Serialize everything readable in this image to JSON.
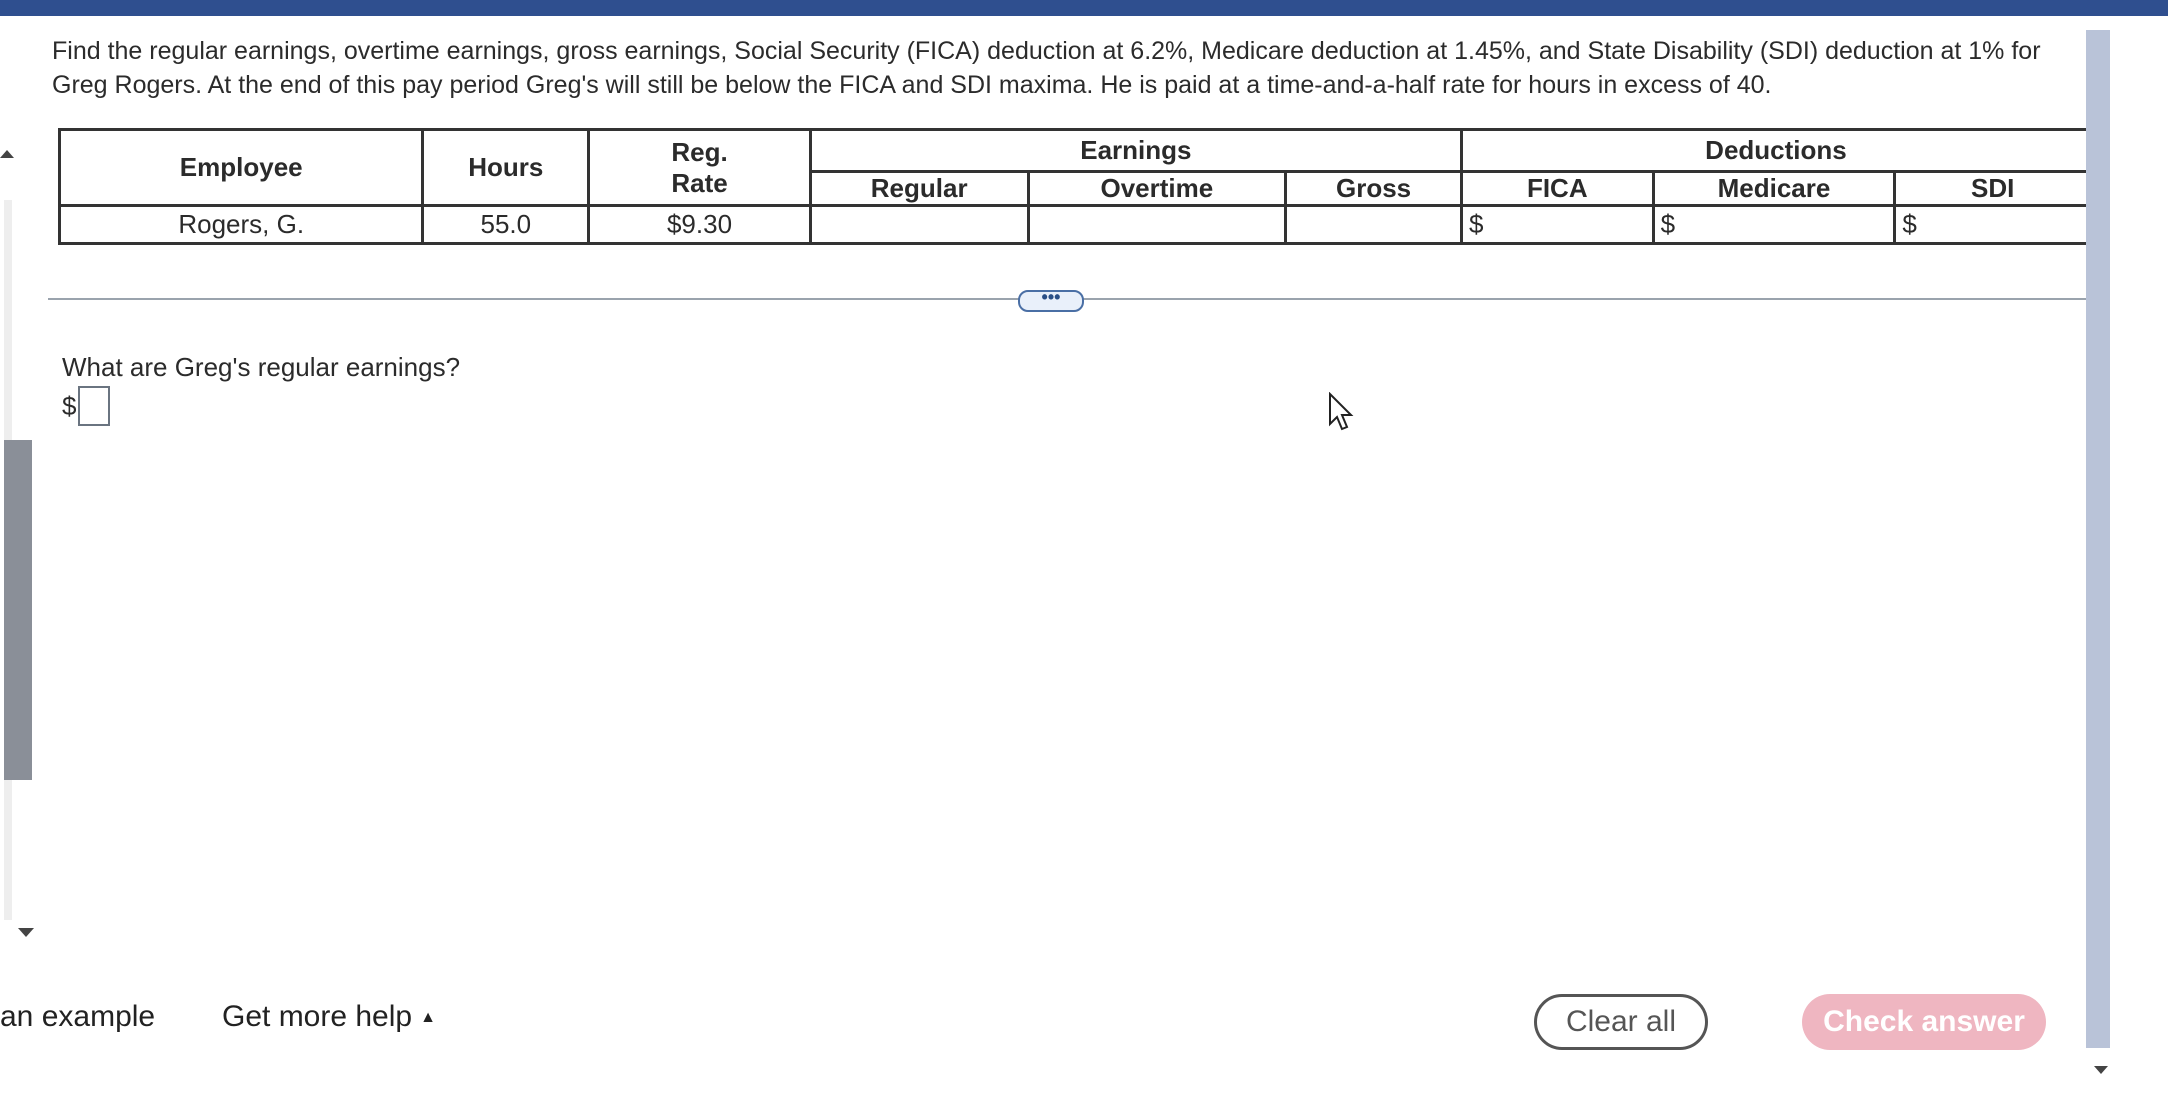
{
  "question": {
    "line1": "Find the regular earnings, overtime earnings, gross earnings, Social Security (FICA) deduction at 6.2%, Medicare deduction at 1.45%, and State Disability (SDI) deduction at 1% for",
    "line2": "Greg Rogers. At the end of this pay period Greg's will still be below the FICA and SDI maxima. He is paid at a time-and-a-half rate for hours in excess of 40."
  },
  "table": {
    "headers": {
      "employee": "Employee",
      "hours": "Hours",
      "reg_rate_line1": "Reg.",
      "reg_rate_line2": "Rate",
      "earnings": "Earnings",
      "deductions": "Deductions",
      "regular": "Regular",
      "overtime": "Overtime",
      "gross": "Gross",
      "fica": "FICA",
      "medicare": "Medicare",
      "sdi": "SDI"
    },
    "row": {
      "employee": "Rogers, G.",
      "hours": "55.0",
      "reg_rate": "$9.30",
      "regular": "",
      "overtime": "",
      "gross": "",
      "fica_prefix": "$",
      "medicare_prefix": "$",
      "sdi_prefix": "$"
    }
  },
  "expand_button": "•••",
  "sub_question": "What are Greg's regular earnings?",
  "answer": {
    "currency": "$",
    "value": ""
  },
  "footer": {
    "view_example": "an example",
    "get_more_help": "Get more help",
    "clear_all": "Clear all",
    "check_answer": "Check answer"
  },
  "colors": {
    "top_bar": "#2f4f8f",
    "check_answer_bg": "#efb6c1",
    "scrollbar": "#b9c3d8"
  }
}
